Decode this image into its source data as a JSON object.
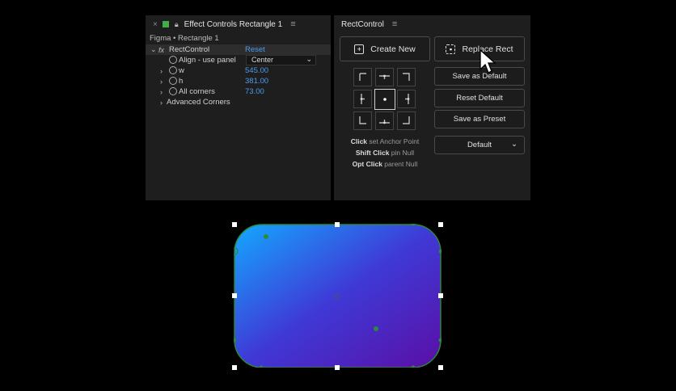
{
  "effect_controls": {
    "tab_title": "Effect Controls Rectangle 1",
    "breadcrumb": "Figma • Rectangle 1",
    "effect_name": "RectControl",
    "reset_label": "Reset",
    "rows": [
      {
        "label": "Align - use panel",
        "value": "Center"
      },
      {
        "label": "w",
        "value": "545.00"
      },
      {
        "label": "h",
        "value": "381.00"
      },
      {
        "label": "All corners",
        "value": "73.00"
      },
      {
        "label": "Advanced Corners",
        "value": ""
      }
    ]
  },
  "rect_control": {
    "tab_title": "RectControl",
    "create_new": "Create New",
    "replace_rect": "Replace Rect",
    "save_as_default": "Save as Default",
    "reset_default": "Reset Default",
    "save_as_preset": "Save as Preset",
    "preset_select": "Default",
    "hints": [
      {
        "bold": "Click",
        "rest": " set Anchor Point"
      },
      {
        "bold": "Shift Click",
        "rest": " pin Null"
      },
      {
        "bold": "Opt Click",
        "rest": " parent Null"
      }
    ]
  },
  "colors": {
    "value_blue": "#4a9bf0",
    "gradient_start": "#14a8ff",
    "gradient_mid": "#3f39d6",
    "gradient_end": "#5a0fa6",
    "selection_green": "#2d8a3a"
  }
}
